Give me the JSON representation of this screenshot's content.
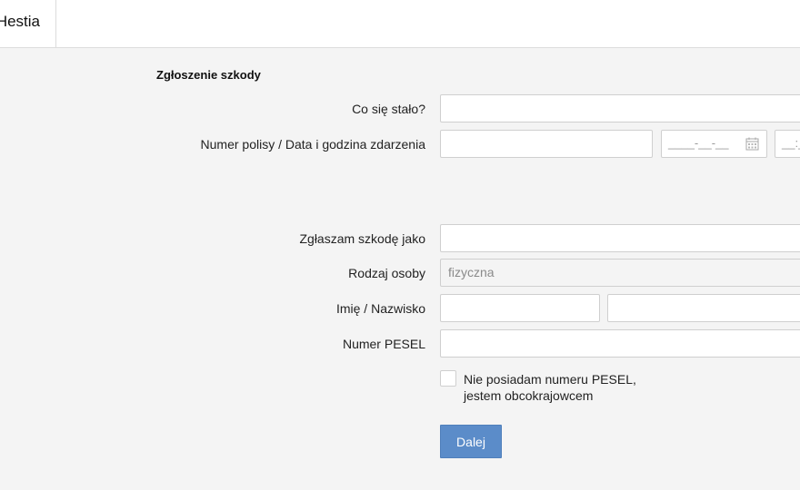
{
  "header": {
    "brand_text": "Hestia"
  },
  "form": {
    "section_title": "Zgłoszenie szkody",
    "what_happened": {
      "label": "Co się stało?",
      "value": ""
    },
    "policy_date": {
      "label": "Numer polisy / Data i godzina zdarzenia",
      "policy_value": "",
      "date_mask": "____-__-__",
      "time_mask": "__:__",
      "calendar_icon": "calendar-icon"
    },
    "reporter_role": {
      "label": "Zgłaszam szkodę jako",
      "value": ""
    },
    "person_type": {
      "label": "Rodzaj osoby",
      "value": "fizyczna"
    },
    "name": {
      "label": "Imię / Nazwisko",
      "first_name": "",
      "last_name": ""
    },
    "pesel": {
      "label": "Numer PESEL",
      "value": ""
    },
    "no_pesel": {
      "line1": "Nie posiadam numeru PESEL,",
      "line2": "jestem obcokrajowcem",
      "checked": false
    },
    "next_button": "Dalej"
  },
  "colors": {
    "accent": "#5b8cc9",
    "background": "#f4f4f4"
  }
}
